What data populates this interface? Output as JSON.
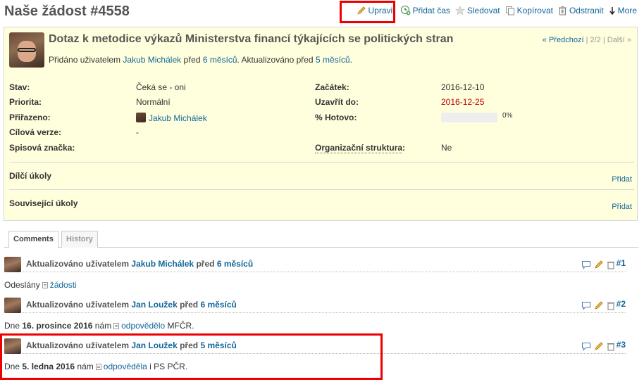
{
  "page": {
    "title": "Naše žádost #4558"
  },
  "toolbar": {
    "edit_label": "Upravit",
    "log_time_label": "Přidat čas",
    "watch_label": "Sledovat",
    "copy_label": "Kopírovat",
    "delete_label": "Odstranit",
    "more_label": "More"
  },
  "issue": {
    "subject": "Dotaz k metodice výkazů Ministerstva financí týkajících se politických stran",
    "author_prefix": "Přidáno uživatelem",
    "author_name": "Jakub Michálek",
    "before": "před",
    "added_ago": "6 měsíců",
    "updated_prefix": ". Aktualizováno před",
    "updated_ago": "5 měsíců",
    "updated_suffix": ".",
    "prev_label": "« Předchozí",
    "position": "| 2/2 |",
    "next_label": "Další »",
    "attributes": {
      "status_label": "Stav:",
      "status_value": "Čeká se - oni",
      "priority_label": "Priorita:",
      "priority_value": "Normální",
      "assignee_label": "Přiřazeno:",
      "assignee_value": "Jakub Michálek",
      "target_label": "Cílová verze:",
      "target_value": "-",
      "docid_label": "Spisová značka:",
      "start_label": "Začátek:",
      "start_value": "2016-12-10",
      "due_label": "Uzavřít do:",
      "due_value": "2016-12-25",
      "done_label": "% Hotovo:",
      "done_value": "0%",
      "done_fraction": 0,
      "org_label": "Organizační struktura",
      "org_colon": ":",
      "org_value": "Ne"
    },
    "subtasks_label": "Dílčí úkoly",
    "subtasks_add": "Přidat",
    "related_label": "Související úkoly",
    "related_add": "Přidat"
  },
  "tabs": [
    "Comments",
    "History"
  ],
  "journal": [
    {
      "prefix": "Aktualizováno uživatelem",
      "user": "Jakub Michálek",
      "before": "před",
      "ago": "6 měsíců",
      "num": "#1",
      "body_a": "Odeslány",
      "body_link": "žádosti"
    },
    {
      "prefix": "Aktualizováno uživatelem",
      "user": "Jan Loužek",
      "before": "před",
      "ago": "6 měsíců",
      "num": "#2",
      "body_a": "Dne",
      "body_bold": "16. prosince 2016",
      "body_b": "nám",
      "body_link": "odpovědělo",
      "body_c": "MFČR."
    },
    {
      "prefix": "Aktualizováno uživatelem",
      "user": "Jan Loužek",
      "before": "před",
      "ago": "5 měsíců",
      "num": "#3",
      "body_a": "Dne",
      "body_bold": "5. ledna 2016",
      "body_b": "nám",
      "body_link": "odpověděla",
      "body_c": "i PS PČR."
    }
  ],
  "colors": {
    "link": "#116699",
    "issue_bg": "#ffffdd",
    "overdue": "#bb0000",
    "highlight": "#ee0000"
  }
}
